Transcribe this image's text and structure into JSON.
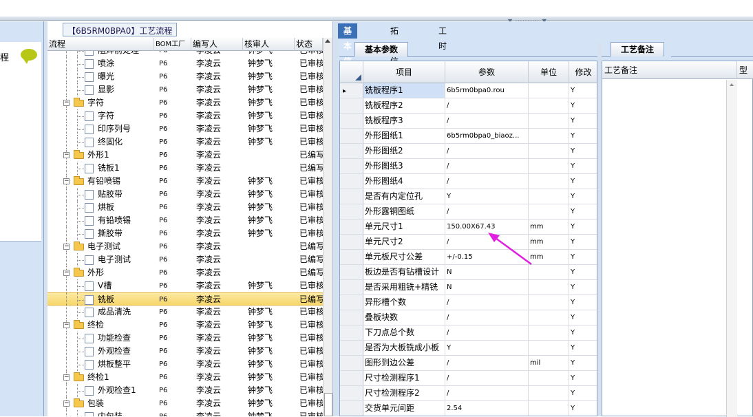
{
  "left_panel": {
    "label": "程"
  },
  "tree": {
    "title": "【6B5RM0BPA0】工艺流程",
    "columns": {
      "flow": "流程",
      "bom": "BOM工厂",
      "writer": "编写人",
      "reviewer": "核审人",
      "status": "状态"
    },
    "rows": [
      {
        "label": "阻焊前处理",
        "bom": "P6",
        "writer": "李凌云",
        "reviewer": "钟梦飞",
        "status": "已审核",
        "level": 2,
        "type": "leaf"
      },
      {
        "label": "喷涂",
        "bom": "P6",
        "writer": "李凌云",
        "reviewer": "钟梦飞",
        "status": "已审核",
        "level": 2,
        "type": "leaf"
      },
      {
        "label": "曝光",
        "bom": "P6",
        "writer": "李凌云",
        "reviewer": "钟梦飞",
        "status": "已审核",
        "level": 2,
        "type": "leaf"
      },
      {
        "label": "显影",
        "bom": "P6",
        "writer": "李凌云",
        "reviewer": "钟梦飞",
        "status": "已审核",
        "level": 2,
        "type": "leaf"
      },
      {
        "label": "字符",
        "bom": "P6",
        "writer": "李凌云",
        "reviewer": "钟梦飞",
        "status": "已审核",
        "level": 1,
        "type": "folder"
      },
      {
        "label": "字符",
        "bom": "P6",
        "writer": "李凌云",
        "reviewer": "钟梦飞",
        "status": "已审核",
        "level": 2,
        "type": "leaf"
      },
      {
        "label": "印序列号",
        "bom": "P6",
        "writer": "李凌云",
        "reviewer": "钟梦飞",
        "status": "已审核",
        "level": 2,
        "type": "leaf"
      },
      {
        "label": "终固化",
        "bom": "P6",
        "writer": "李凌云",
        "reviewer": "钟梦飞",
        "status": "已审核",
        "level": 2,
        "type": "leaf"
      },
      {
        "label": "外形1",
        "bom": "P6",
        "writer": "李凌云",
        "reviewer": "",
        "status": "已编写",
        "level": 1,
        "type": "folder"
      },
      {
        "label": "铣板1",
        "bom": "P6",
        "writer": "李凌云",
        "reviewer": "",
        "status": "已编写",
        "level": 2,
        "type": "leaf"
      },
      {
        "label": "有铅喷锡",
        "bom": "P6",
        "writer": "李凌云",
        "reviewer": "钟梦飞",
        "status": "已审核",
        "level": 1,
        "type": "folder"
      },
      {
        "label": "贴胶带",
        "bom": "P6",
        "writer": "李凌云",
        "reviewer": "钟梦飞",
        "status": "已审核",
        "level": 2,
        "type": "leaf"
      },
      {
        "label": "烘板",
        "bom": "P6",
        "writer": "李凌云",
        "reviewer": "钟梦飞",
        "status": "已审核",
        "level": 2,
        "type": "leaf"
      },
      {
        "label": "有铅喷锡",
        "bom": "P6",
        "writer": "李凌云",
        "reviewer": "钟梦飞",
        "status": "已审核",
        "level": 2,
        "type": "leaf"
      },
      {
        "label": "撕胶带",
        "bom": "P6",
        "writer": "李凌云",
        "reviewer": "钟梦飞",
        "status": "已审核",
        "level": 2,
        "type": "leaf"
      },
      {
        "label": "电子测试",
        "bom": "P6",
        "writer": "李凌云",
        "reviewer": "",
        "status": "已编写",
        "level": 1,
        "type": "folder"
      },
      {
        "label": "电子测试",
        "bom": "P6",
        "writer": "李凌云",
        "reviewer": "",
        "status": "已编写",
        "level": 2,
        "type": "leaf"
      },
      {
        "label": "外形",
        "bom": "P6",
        "writer": "李凌云",
        "reviewer": "",
        "status": "已编写",
        "level": 1,
        "type": "folder"
      },
      {
        "label": "V槽",
        "bom": "P6",
        "writer": "李凌云",
        "reviewer": "钟梦飞",
        "status": "已审核",
        "level": 2,
        "type": "leaf"
      },
      {
        "label": "铣板",
        "bom": "P6",
        "writer": "李凌云",
        "reviewer": "",
        "status": "已编写",
        "level": 2,
        "type": "leaf",
        "selected": true
      },
      {
        "label": "成品清洗",
        "bom": "P6",
        "writer": "李凌云",
        "reviewer": "钟梦飞",
        "status": "已审核",
        "level": 2,
        "type": "leaf"
      },
      {
        "label": "终检",
        "bom": "P6",
        "writer": "李凌云",
        "reviewer": "钟梦飞",
        "status": "已审核",
        "level": 1,
        "type": "folder"
      },
      {
        "label": "功能检查",
        "bom": "P6",
        "writer": "李凌云",
        "reviewer": "钟梦飞",
        "status": "已审核",
        "level": 2,
        "type": "leaf"
      },
      {
        "label": "外观检查",
        "bom": "P6",
        "writer": "李凌云",
        "reviewer": "钟梦飞",
        "status": "已审核",
        "level": 2,
        "type": "leaf"
      },
      {
        "label": "烘板整平",
        "bom": "P6",
        "writer": "李凌云",
        "reviewer": "钟梦飞",
        "status": "已审核",
        "level": 2,
        "type": "leaf"
      },
      {
        "label": "终检1",
        "bom": "P6",
        "writer": "李凌云",
        "reviewer": "钟梦飞",
        "status": "已审核",
        "level": 1,
        "type": "folder"
      },
      {
        "label": "外观检查1",
        "bom": "P6",
        "writer": "李凌云",
        "reviewer": "钟梦飞",
        "status": "已审核",
        "level": 2,
        "type": "leaf"
      },
      {
        "label": "包装",
        "bom": "P6",
        "writer": "李凌云",
        "reviewer": "钟梦飞",
        "status": "已审核",
        "level": 1,
        "type": "folder"
      },
      {
        "label": "内包装",
        "bom": "P6",
        "writer": "李凌云",
        "reviewer": "钟梦飞",
        "status": "已审核",
        "level": 2,
        "type": "leaf"
      }
    ]
  },
  "right": {
    "tabs": [
      "基本信息",
      "拓展信息",
      "工时"
    ],
    "subtab": "基本参数",
    "note_tab": "工艺备注",
    "grid_columns": {
      "item": "项目",
      "param": "参数",
      "unit": "单位",
      "modify": "修改"
    },
    "note_columns": {
      "note": "工艺备注",
      "model": "型号"
    },
    "params": [
      {
        "item": "铣板程序1",
        "value": "6b5rm0bpa0.rou",
        "unit": "",
        "mod": "Y"
      },
      {
        "item": "铣板程序2",
        "value": "/",
        "unit": "",
        "mod": "Y"
      },
      {
        "item": "铣板程序3",
        "value": "/",
        "unit": "",
        "mod": "Y"
      },
      {
        "item": "外形图纸1",
        "value": "6b5rm0bpa0_biaoz...",
        "unit": "",
        "mod": "Y"
      },
      {
        "item": "外形图纸2",
        "value": "/",
        "unit": "",
        "mod": "Y"
      },
      {
        "item": "外形图纸3",
        "value": "/",
        "unit": "",
        "mod": "Y"
      },
      {
        "item": "外形图纸4",
        "value": "/",
        "unit": "",
        "mod": "Y"
      },
      {
        "item": "是否有内定位孔",
        "value": "Y",
        "unit": "",
        "mod": "Y"
      },
      {
        "item": "外形露铜图纸",
        "value": "/",
        "unit": "",
        "mod": "Y"
      },
      {
        "item": "单元尺寸1",
        "value": "150.00X67.43",
        "unit": "mm",
        "mod": "Y"
      },
      {
        "item": "单元尺寸2",
        "value": "/",
        "unit": "mm",
        "mod": "Y"
      },
      {
        "item": "单元板尺寸公差",
        "value": "+/-0.15",
        "unit": "mm",
        "mod": "Y"
      },
      {
        "item": "板边是否有钻槽设计",
        "value": "N",
        "unit": "",
        "mod": "Y"
      },
      {
        "item": "是否采用粗铣+精铣",
        "value": "N",
        "unit": "",
        "mod": "Y"
      },
      {
        "item": "异形槽个数",
        "value": "/",
        "unit": "",
        "mod": "Y"
      },
      {
        "item": "叠板块数",
        "value": "/",
        "unit": "",
        "mod": "Y"
      },
      {
        "item": "下刀点总个数",
        "value": "/",
        "unit": "",
        "mod": "Y"
      },
      {
        "item": "是否为大板铣成小板",
        "value": "Y",
        "unit": "",
        "mod": "Y"
      },
      {
        "item": "图形到边公差",
        "value": "/",
        "unit": "mil",
        "mod": "Y"
      },
      {
        "item": "尺寸检测程序1",
        "value": "/",
        "unit": "",
        "mod": "Y"
      },
      {
        "item": "尺寸检测程序2",
        "value": "/",
        "unit": "",
        "mod": "Y"
      },
      {
        "item": "交货单元间距",
        "value": "2.54",
        "unit": "",
        "mod": "Y"
      }
    ]
  },
  "colors": {
    "accent_tab": "#3b6fb6",
    "annotation_arrow": "#e020e0",
    "selection": "#f6d66a"
  }
}
